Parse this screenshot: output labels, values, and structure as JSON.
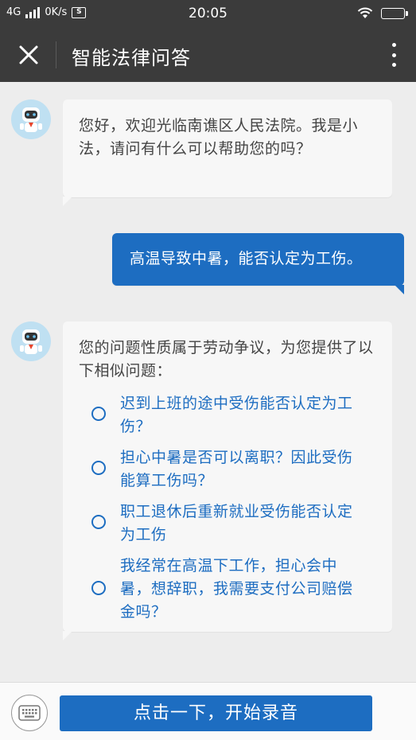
{
  "status_bar": {
    "network": "4G",
    "speed": "0K/s",
    "screenshot_badge": "S",
    "time": "20:05"
  },
  "header": {
    "title": "智能法律问答",
    "close_icon": "close-icon",
    "more_icon": "more-vertical-icon"
  },
  "messages": [
    {
      "sender": "bot",
      "text": "您好，欢迎光临南谯区人民法院。我是小法，请问有什么可以帮助您的吗？"
    },
    {
      "sender": "user",
      "text": "高温导致中暑，能否认定为工伤。"
    },
    {
      "sender": "bot",
      "text": "您的问题性质属于劳动争议，为您提供了以下相似问题：",
      "suggestions": [
        "迟到上班的途中受伤能否认定为工伤？",
        "担心中暑是否可以离职？因此受伤能算工伤吗？",
        "职工退休后重新就业受伤能否认定为工伤",
        "我经常在高温下工作，担心会中暑，想辞职，我需要支付公司赔偿金吗？"
      ]
    }
  ],
  "bottom": {
    "keyboard_icon": "keyboard-icon",
    "record_label": "点击一下，开始录音"
  },
  "colors": {
    "bar_bg": "#3b3b3b",
    "accent": "#1d6dc1",
    "page_bg": "#ededed",
    "bubble_bg": "#f7f7f7"
  }
}
